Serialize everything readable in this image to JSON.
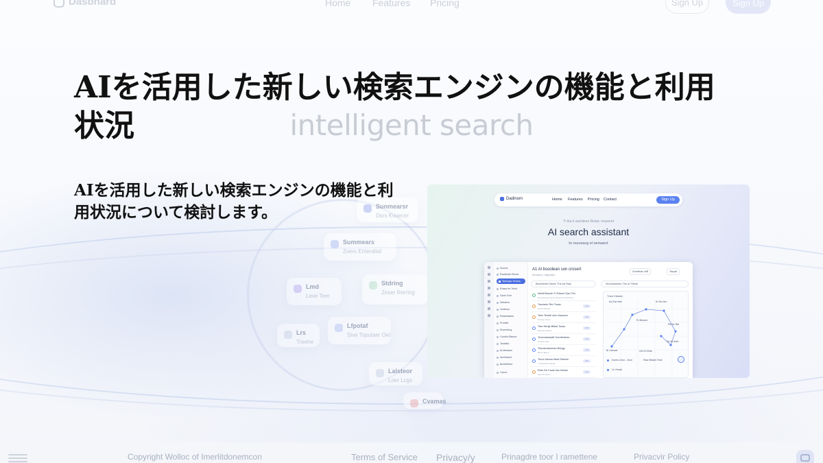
{
  "background": {
    "nav": {
      "brand": "Dasbhard",
      "links": [
        "Home",
        "Features",
        "Pricing"
      ],
      "signup_outline": "Sign Up",
      "signup_solid": "Sign Up"
    },
    "headline_line1": "intelligent search",
    "cards": [
      {
        "title": "Sunmearsr",
        "sub": "Dsrs Kvuecer"
      },
      {
        "title": "Summears",
        "sub": "Zvers Enteraltal"
      },
      {
        "title": "Lmd",
        "sub": "Leve Teer"
      },
      {
        "title": "Stdring",
        "sub": "Zeser Rerring"
      },
      {
        "title": "Lfpotaf",
        "sub": "Sive Topulaer Oet"
      },
      {
        "title": "Lrs",
        "sub": "Treehe"
      },
      {
        "title": "Lalsteor",
        "sub": "Loer Lcgs"
      },
      {
        "title": "Cvamas",
        "sub": ""
      }
    ],
    "footer": {
      "copyright": "Copyright Wolloc of Imerlitdonemcon",
      "terms": "Terms of Service",
      "privacy": "Privacy/y",
      "language": "Prinagdre toor I ramettene",
      "privacy_policy": "Privacvir Policy"
    }
  },
  "hero": {
    "title": "AIを活用した新しい検索エンジンの機能と利用状況",
    "description": "AIを活用した新しい検索エンジンの機能と利用状況について検討します。"
  },
  "screenshot": {
    "nav": {
      "brand": "Dadinom",
      "links": [
        "Home",
        "Features",
        "Pricing",
        "Contact"
      ],
      "signup": "Sign Up"
    },
    "kicker": "Tr tka ti averiteen Bniaic cmoeent",
    "title": "AI search assistant",
    "subtitle": "to rouceacg el oersaect",
    "app": {
      "sidebar": [
        "Soores",
        "Raosinale Rsrcot",
        "Stanoqor Hroess",
        "Rnsae fer Tenot",
        "Gane Grnt",
        "Setiahes",
        "Hovtleso",
        "Resantaalsa",
        "Pruetlet",
        "Rovnrtiong",
        "Ccunlto Blaona",
        "Tanlasto",
        "Al Mestaes",
        "Asvrifraoid",
        "Bonteltitrea",
        "Ccmre"
      ],
      "main_title": "A1 Al bsoolean son crosert",
      "main_sub": "benaeno, ntaptnen",
      "tool_1": "Sorettnar caR",
      "tool_2": "Terpail",
      "search_1": "Banimertev Beers The Ad Raol",
      "search_2": "Sennoltoertes The ar Ftlmet",
      "rows": [
        {
          "title": "Nehiil Bramin Tt Rasmi Clan Tim",
          "sub": "Romocersromeres Henenal Od Rosnet",
          "badge": ""
        },
        {
          "title": "Tounseer Rer Tooss",
          "sub": "Cxrrls Retoter",
          "badge": "4 4"
        },
        {
          "title": "Toes Texeth ulon Gasoom",
          "sub": "Ttierise Nesto",
          "badge": "4 4"
        },
        {
          "title": "Ttan Henjir Biteal Tooss",
          "sub": "Dserlsce Ritols",
          "badge": "4 4"
        },
        {
          "title": "Tkomntanswilt Gorefentees",
          "sub": "Cartons Tels",
          "badge": "4 4"
        },
        {
          "title": "Tkeoseuiceanes Bnhgp",
          "sub": "Beme Bpenr",
          "badge": "4 4"
        },
        {
          "title": "Tfuno Dsranr Ilteal Rreteet",
          "sub": "Tmdrsehas Pntotal",
          "badge": "4 4"
        },
        {
          "title": "Rotn De Crusk Ilos Noese",
          "sub": "Tasnoe Vhem",
          "badge": "4 4"
        }
      ],
      "map": {
        "header": "Tnes Clesnic",
        "labels": [
          "As Dne Nee",
          "Sr Bnr Aer",
          "Ple Nr Rtit",
          "Pr-Beseve",
          "Sa Ze Aerit",
          "Br Ctensel",
          "Cbl Rt Clirte"
        ],
        "legend_1": "Sunieo Zdor - Zulor",
        "legend_2": "Rsia Nbtaeri Ruel",
        "legend_3": "Cn Hossir"
      }
    }
  },
  "colors": {
    "accent": "#4c6fe0",
    "signup_bg": "#5b82f0"
  }
}
